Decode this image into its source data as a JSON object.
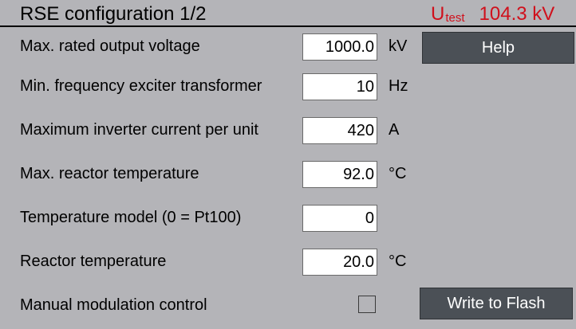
{
  "header": {
    "title": "RSE configuration 1/2",
    "utest": {
      "symbol": "U",
      "subscript": "test",
      "value": "104.3 kV"
    }
  },
  "rows": [
    {
      "label": "Max. rated output voltage",
      "value": "1000.0",
      "unit": "kV"
    },
    {
      "label": "Min. frequency exciter transformer",
      "value": "10",
      "unit": "Hz"
    },
    {
      "label": "Maximum inverter current per unit",
      "value": "420",
      "unit": "A"
    },
    {
      "label": "Max. reactor temperature",
      "value": "92.0",
      "unit": "°C"
    },
    {
      "label": "Temperature model (0 = Pt100)",
      "value": "0",
      "unit": ""
    },
    {
      "label": "Reactor temperature",
      "value": "20.0",
      "unit": "°C"
    }
  ],
  "manual_modulation": {
    "label": "Manual modulation control",
    "checked": false
  },
  "buttons": {
    "help": "Help",
    "write_flash": "Write to Flash"
  },
  "colors": {
    "background": "#b4b4b8",
    "accent_red": "#d0101c",
    "button": "#4b5056",
    "field": "#ffffff"
  }
}
